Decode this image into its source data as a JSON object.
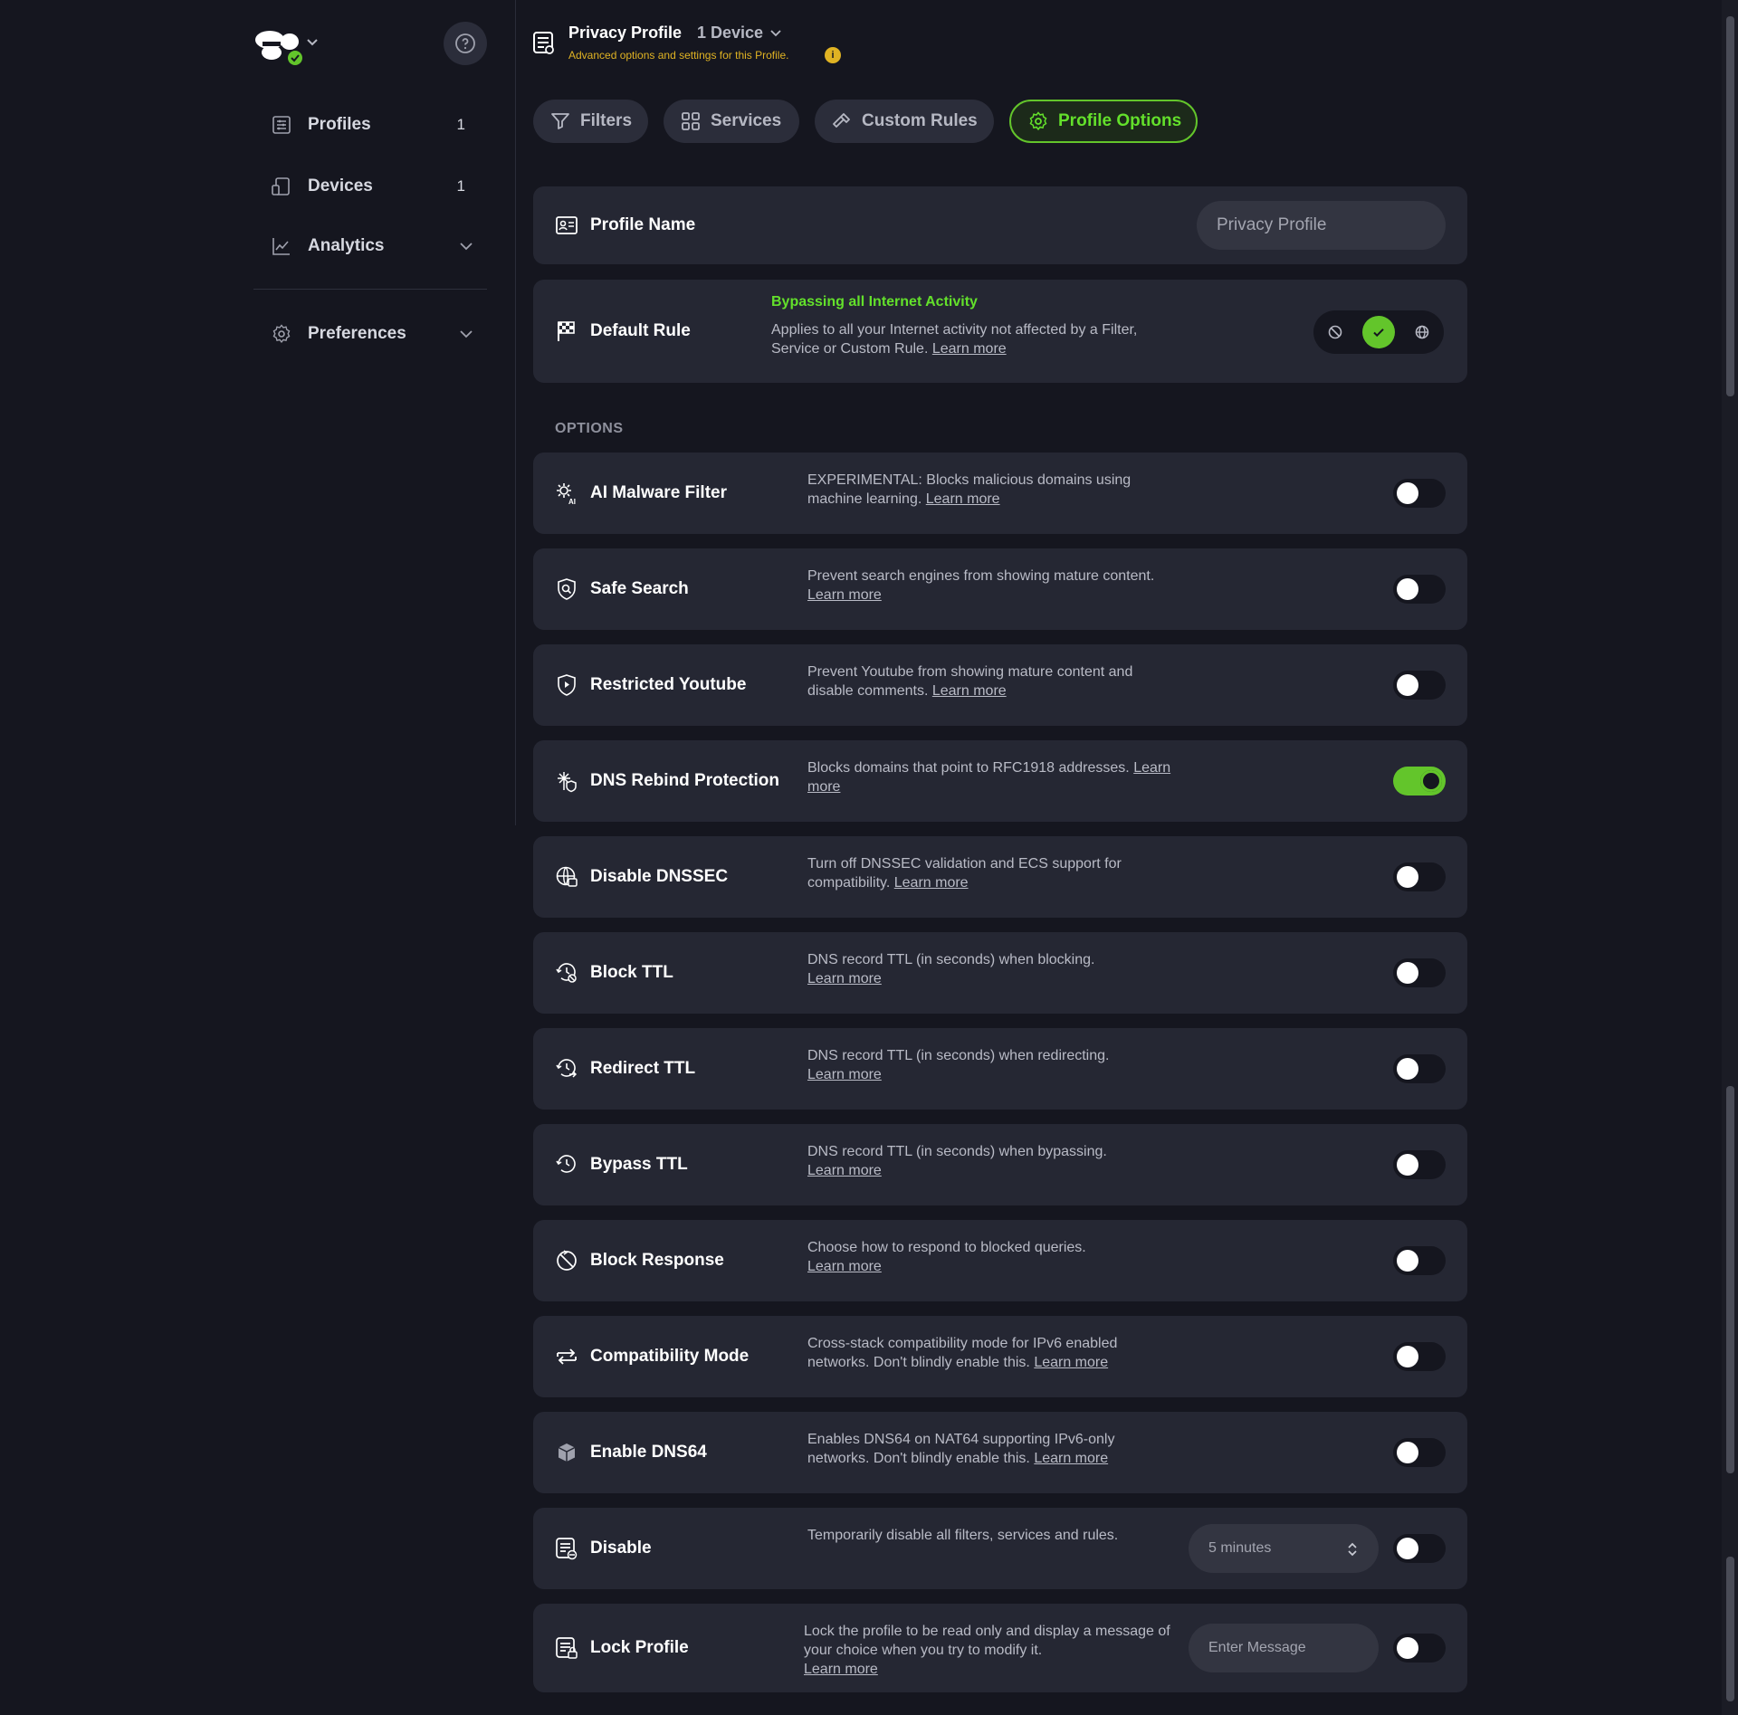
{
  "sidebar": {
    "items": [
      {
        "label": "Profiles",
        "count": "1",
        "icon": "profiles-icon"
      },
      {
        "label": "Devices",
        "count": "1",
        "icon": "devices-icon"
      },
      {
        "label": "Analytics",
        "icon": "analytics-icon"
      },
      {
        "label": "Preferences",
        "icon": "gear-icon"
      }
    ]
  },
  "header": {
    "title": "Privacy Profile",
    "device_selector": "1 Device",
    "subtitle": "Advanced options and settings for this Profile.",
    "info": "i"
  },
  "tabs": [
    {
      "label": "Filters",
      "icon": "filter-icon"
    },
    {
      "label": "Services",
      "icon": "grid-icon"
    },
    {
      "label": "Custom Rules",
      "icon": "hammer-icon"
    },
    {
      "label": "Profile Options",
      "icon": "gear-icon",
      "active": true
    }
  ],
  "profile_name": {
    "label": "Profile Name",
    "placeholder": "Privacy Profile"
  },
  "default_rule": {
    "label": "Default Rule",
    "status": "Bypassing all Internet Activity",
    "description": "Applies to all your Internet activity not affected by a Filter, Service or Custom Rule.",
    "learn_more": "Learn more",
    "selected": "bypass"
  },
  "options_heading": "OPTIONS",
  "options": [
    {
      "label": "AI Malware Filter",
      "description": "EXPERIMENTAL: Blocks malicious domains using machine learning.",
      "learn_more": "Learn more",
      "enabled": false
    },
    {
      "label": "Safe Search",
      "description": "Prevent search engines from showing mature content.",
      "learn_more": "Learn more",
      "enabled": false
    },
    {
      "label": "Restricted Youtube",
      "description": "Prevent Youtube from showing mature content and disable comments.",
      "learn_more": "Learn more",
      "enabled": false
    },
    {
      "label": "DNS Rebind Protection",
      "description": "Blocks domains that point to RFC1918 addresses.",
      "learn_more": "Learn more",
      "enabled": true
    },
    {
      "label": "Disable DNSSEC",
      "description": "Turn off DNSSEC validation and ECS support for compatibility.",
      "learn_more": "Learn more",
      "enabled": false
    },
    {
      "label": "Block TTL",
      "description": "DNS record TTL (in seconds) when blocking.",
      "learn_more": "Learn more",
      "enabled": false
    },
    {
      "label": "Redirect TTL",
      "description": "DNS record TTL (in seconds) when redirecting.",
      "learn_more": "Learn more",
      "enabled": false
    },
    {
      "label": "Bypass TTL",
      "description": "DNS record TTL (in seconds) when bypassing.",
      "learn_more": "Learn more",
      "enabled": false
    },
    {
      "label": "Block Response",
      "description": "Choose how to respond to blocked queries.",
      "learn_more": "Learn more",
      "enabled": false
    },
    {
      "label": "Compatibility Mode",
      "description": "Cross-stack compatibility mode for IPv6 enabled networks. Don't blindly enable this.",
      "learn_more": "Learn more",
      "enabled": false
    },
    {
      "label": "Enable DNS64",
      "description": "Enables DNS64 on NAT64 supporting IPv6-only networks. Don't blindly enable this.",
      "learn_more": "Learn more",
      "enabled": false
    },
    {
      "label": "Disable",
      "description": "Temporarily disable all filters, services and rules.",
      "select_value": "5 minutes",
      "enabled": false
    },
    {
      "label": "Lock Profile",
      "description": "Lock the profile to be read only and display a message of your choice when you try to modify it.",
      "learn_more": "Learn more",
      "input_placeholder": "Enter Message",
      "enabled": false
    }
  ],
  "colors": {
    "accent": "#63c52b",
    "warning": "#e0b323",
    "background": "#15161f",
    "card": "#252733"
  }
}
